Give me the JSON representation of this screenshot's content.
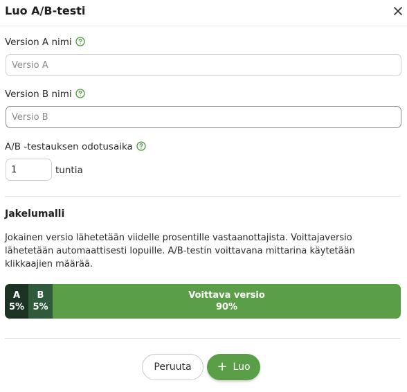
{
  "dialog": {
    "title": "Luo A/B-testi"
  },
  "form": {
    "version_a": {
      "label": "Version A nimi",
      "placeholder": "Versio A",
      "value": ""
    },
    "version_b": {
      "label": "Version B nimi",
      "placeholder": "Versio B",
      "value": ""
    },
    "wait_time": {
      "label": "A/B -testauksen odotusaika",
      "value": "1",
      "unit": "tuntia"
    }
  },
  "distribution": {
    "title": "Jakelumalli",
    "description": "Jokainen versio lähetetään viidelle prosentille vastaanottajista. Voittajaversio lähetetään automaattisesti lopuille. A/B-testin voittavana mittarina käytetään klikkaajien määrää.",
    "segments": [
      {
        "label": "A",
        "percent": "5%"
      },
      {
        "label": "B",
        "percent": "5%"
      },
      {
        "label": "Voittava versio",
        "percent": "90%"
      }
    ]
  },
  "actions": {
    "cancel_label": "Peruuta",
    "create_label": "Luo"
  },
  "colors": {
    "accent": "#5a9e47",
    "segment_a": "#1c3323",
    "segment_b": "#2f5a3b"
  },
  "icons": {
    "close": "close-icon",
    "help": "help-circle-icon",
    "plus": "plus-icon"
  }
}
